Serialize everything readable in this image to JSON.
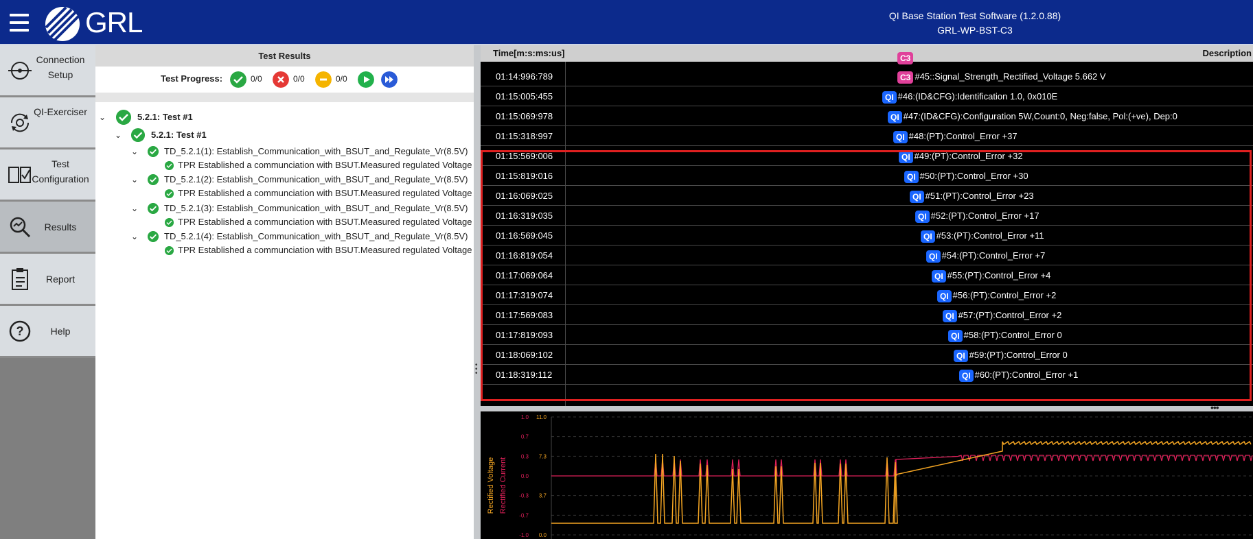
{
  "header": {
    "title": "QI Base Station Test Software (1.2.0.88)",
    "subtitle": "GRL-WP-BST-C3",
    "logo_text": "GRL",
    "menu_icon": "hamburger-menu-icon"
  },
  "sidebar": {
    "items": [
      {
        "label": "Connection Setup",
        "icon": "connection-icon",
        "active": false
      },
      {
        "label": "QI-Exerciser",
        "icon": "exerciser-icon",
        "active": false
      },
      {
        "label": "Test Configuration",
        "icon": "test-config-icon",
        "active": false
      },
      {
        "label": "Results",
        "icon": "results-search-icon",
        "active": true
      },
      {
        "label": "Report",
        "icon": "report-clipboard-icon",
        "active": false
      },
      {
        "label": "Help",
        "icon": "help-icon",
        "active": false
      }
    ]
  },
  "results": {
    "title": "Test Results",
    "progress_label": "Test Progress:",
    "pass_count": "0/0",
    "fail_count": "0/0",
    "warn_count": "0/0",
    "tree": [
      {
        "level": 0,
        "label": "5.2.1: Test #1",
        "bold": true,
        "expand": true
      },
      {
        "level": 1,
        "label": "5.2.1: Test #1",
        "bold": true,
        "expand": true
      },
      {
        "level": 2,
        "label": "TD_5.2.1(1): Establish_Communication_with_BSUT_and_Regulate_Vr(8.5V)",
        "bold": false,
        "expand": true
      },
      {
        "level": 3,
        "label": "TPR Established a communciation with BSUT.Measured regulated Voltage",
        "bold": false,
        "expand": false
      },
      {
        "level": 2,
        "label": "TD_5.2.1(2): Establish_Communication_with_BSUT_and_Regulate_Vr(8.5V)",
        "bold": false,
        "expand": true
      },
      {
        "level": 3,
        "label": "TPR Established a communciation with BSUT.Measured regulated Voltage",
        "bold": false,
        "expand": false
      },
      {
        "level": 2,
        "label": "TD_5.2.1(3): Establish_Communication_with_BSUT_and_Regulate_Vr(8.5V)",
        "bold": false,
        "expand": true
      },
      {
        "level": 3,
        "label": "TPR Established a communciation with BSUT.Measured regulated Voltage",
        "bold": false,
        "expand": false
      },
      {
        "level": 2,
        "label": "TD_5.2.1(4): Establish_Communication_with_BSUT_and_Regulate_Vr(8.5V)",
        "bold": false,
        "expand": true
      },
      {
        "level": 3,
        "label": "TPR Established a communciation with BSUT.Measured regulated Voltage",
        "bold": false,
        "expand": false
      }
    ]
  },
  "log": {
    "columns": {
      "time": "Time[m:s:ms:us]",
      "description": "Description"
    },
    "rows": [
      {
        "time": "01:14:996:789",
        "badge": "C3",
        "badge_color": "#e0409a",
        "text": "#45::Signal_Strength_Rectified_Voltage 5.662 V"
      },
      {
        "time": "01:15:005:455",
        "badge": "QI",
        "badge_color": "#1a66ff",
        "text": "#46:(ID&CFG):Identification 1.0, 0x010E"
      },
      {
        "time": "01:15:069:978",
        "badge": "QI",
        "badge_color": "#1a66ff",
        "text": "#47:(ID&CFG):Configuration 5W,Count:0, Neg:false, Pol:(+ve), Dep:0"
      },
      {
        "time": "01:15:318:997",
        "badge": "QI",
        "badge_color": "#1a66ff",
        "text": "#48:(PT):Control_Error +37"
      },
      {
        "time": "01:15:569:006",
        "badge": "QI",
        "badge_color": "#1a66ff",
        "text": "#49:(PT):Control_Error +32"
      },
      {
        "time": "01:15:819:016",
        "badge": "QI",
        "badge_color": "#1a66ff",
        "text": "#50:(PT):Control_Error +30"
      },
      {
        "time": "01:16:069:025",
        "badge": "QI",
        "badge_color": "#1a66ff",
        "text": "#51:(PT):Control_Error +23"
      },
      {
        "time": "01:16:319:035",
        "badge": "QI",
        "badge_color": "#1a66ff",
        "text": "#52:(PT):Control_Error +17"
      },
      {
        "time": "01:16:569:045",
        "badge": "QI",
        "badge_color": "#1a66ff",
        "text": "#53:(PT):Control_Error +11"
      },
      {
        "time": "01:16:819:054",
        "badge": "QI",
        "badge_color": "#1a66ff",
        "text": "#54:(PT):Control_Error +7"
      },
      {
        "time": "01:17:069:064",
        "badge": "QI",
        "badge_color": "#1a66ff",
        "text": "#55:(PT):Control_Error +4"
      },
      {
        "time": "01:17:319:074",
        "badge": "QI",
        "badge_color": "#1a66ff",
        "text": "#56:(PT):Control_Error +2"
      },
      {
        "time": "01:17:569:083",
        "badge": "QI",
        "badge_color": "#1a66ff",
        "text": "#57:(PT):Control_Error +2"
      },
      {
        "time": "01:17:819:093",
        "badge": "QI",
        "badge_color": "#1a66ff",
        "text": "#58:(PT):Control_Error 0"
      },
      {
        "time": "01:18:069:102",
        "badge": "QI",
        "badge_color": "#1a66ff",
        "text": "#59:(PT):Control_Error 0"
      },
      {
        "time": "01:18:319:112",
        "badge": "QI",
        "badge_color": "#1a66ff",
        "text": "#60:(PT):Control_Error +1"
      }
    ],
    "highlight_color": "#e02020"
  },
  "chart": {
    "left_axis_label": "Rectified Voltage",
    "left_axis_color": "#f5a623",
    "left_ticks": [
      "11.0",
      "7.3",
      "3.7",
      "0.0"
    ],
    "right_axis_label": "Rectified Current",
    "right_axis_color": "#e0205a",
    "right_ticks": [
      "1.0",
      "0.7",
      "0.3",
      "0.0",
      "-0.3",
      "-0.7",
      "-1.0"
    ]
  },
  "colors": {
    "header_bg": "#0c2a8c",
    "pass": "#2aa843",
    "fail": "#e53935",
    "warn": "#f5b400",
    "run": "#22b14c",
    "fast": "#2a5bd7"
  }
}
